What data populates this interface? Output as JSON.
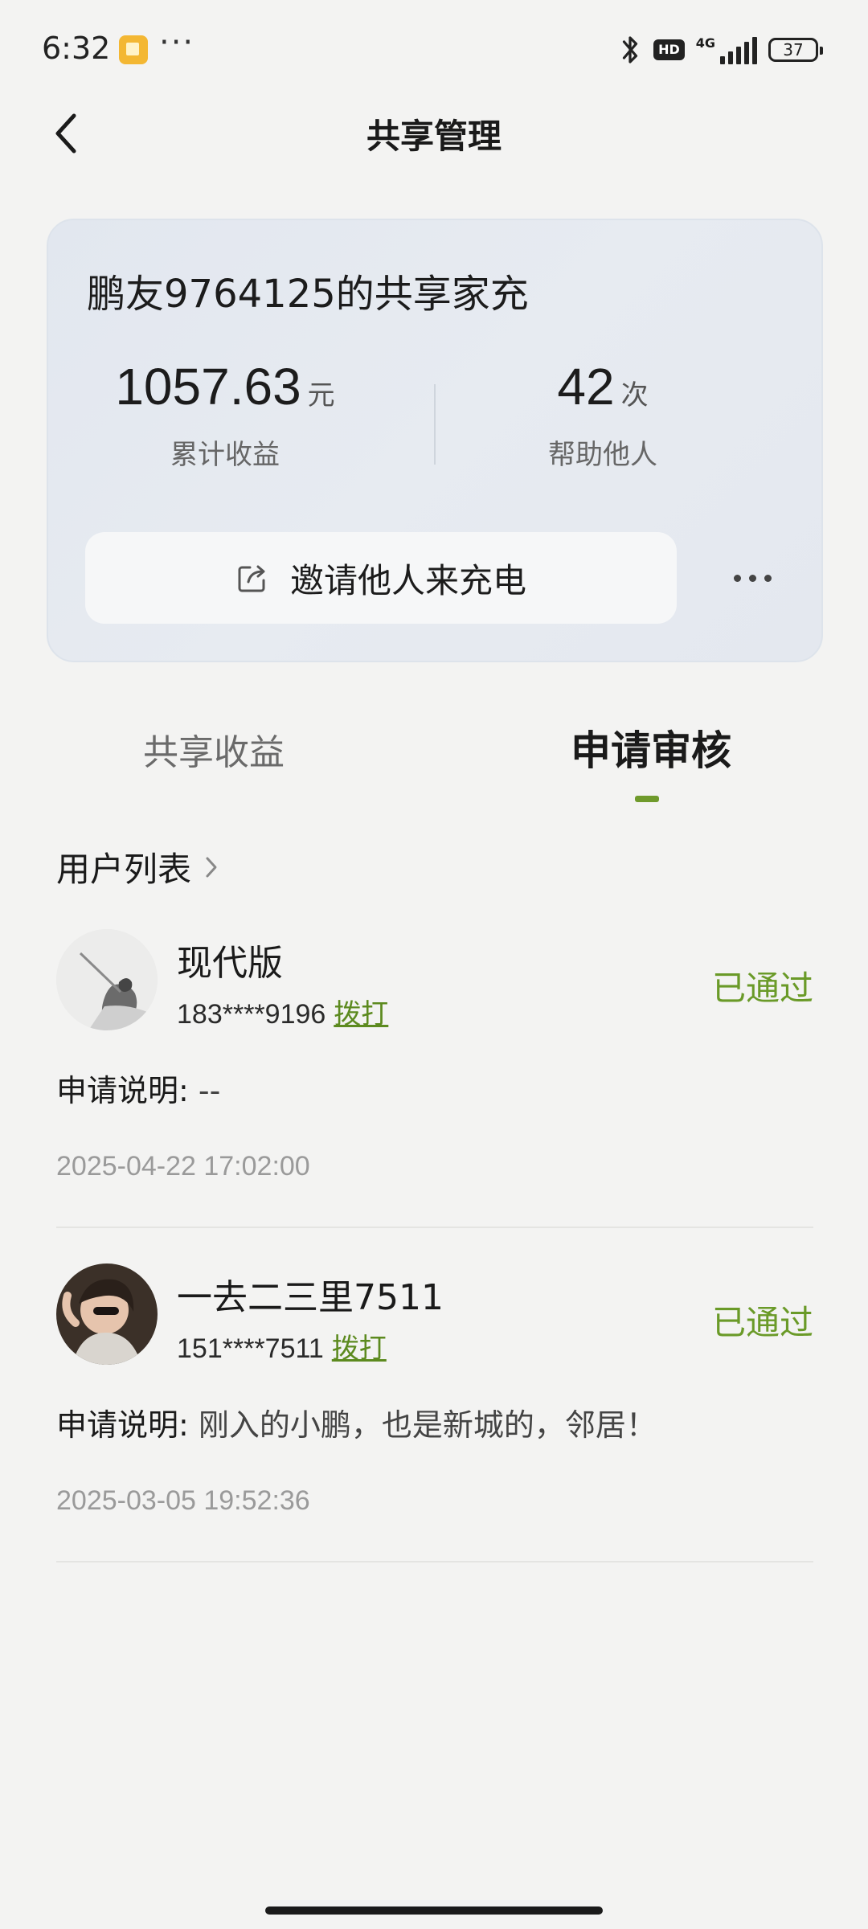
{
  "status_bar": {
    "time": "6:32",
    "more": "···",
    "hd": "HD",
    "network": "4G",
    "battery": "37"
  },
  "header": {
    "title": "共享管理"
  },
  "card": {
    "title": "鹏友9764125的共享家充",
    "earnings_value": "1057.63",
    "earnings_unit": "元",
    "earnings_label": "累计收益",
    "helped_value": "42",
    "helped_unit": "次",
    "helped_label": "帮助他人",
    "invite_label": "邀请他人来充电"
  },
  "tabs": [
    {
      "label": "共享收益",
      "active": false
    },
    {
      "label": "申请审核",
      "active": true
    }
  ],
  "list": {
    "title": "用户列表",
    "note_prefix": "申请说明:",
    "call_label": "拨打",
    "entries": [
      {
        "name": "现代版",
        "phone": "183****9196",
        "status": "已通过",
        "note": "--",
        "time": "2025-04-22 17:02:00"
      },
      {
        "name": "一去二三里7511",
        "phone": "151****7511",
        "status": "已通过",
        "note": "刚入的小鹏，也是新城的，邻居！",
        "time": "2025-03-05 19:52:36"
      }
    ]
  },
  "colors": {
    "accent_green": "#6a9a28",
    "background": "#f3f3f2",
    "card": "#e4e8ef"
  }
}
